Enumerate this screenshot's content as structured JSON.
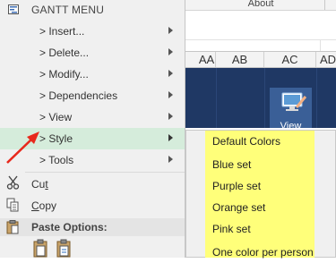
{
  "background": {
    "ribbon_tab": "About",
    "column_headers": [
      "AA",
      "AB",
      "AC",
      "AD"
    ],
    "tile_label": "View"
  },
  "menu": {
    "title": "GANTT MENU",
    "items": [
      {
        "label": "> Insert..."
      },
      {
        "label": "> Delete..."
      },
      {
        "label": "> Modify..."
      },
      {
        "label": "> Dependencies"
      },
      {
        "label": "> View"
      },
      {
        "label": "> Style"
      },
      {
        "label": "> Tools"
      }
    ],
    "cut": {
      "prefix": "Cu",
      "accel": "t",
      "suffix": ""
    },
    "copy": {
      "prefix": "",
      "accel": "C",
      "suffix": "opy"
    },
    "paste_options_label": "Paste Options:"
  },
  "submenu": {
    "items": [
      "Default Colors",
      "Blue set",
      "Purple set",
      "Orange set",
      "Pink set",
      "One color per person"
    ]
  },
  "colors": {
    "highlight": "#d5ecdb",
    "submenu_highlight": "#ffff7a",
    "annotation_arrow": "#e8281c",
    "grid_dark": "#1f3864"
  }
}
